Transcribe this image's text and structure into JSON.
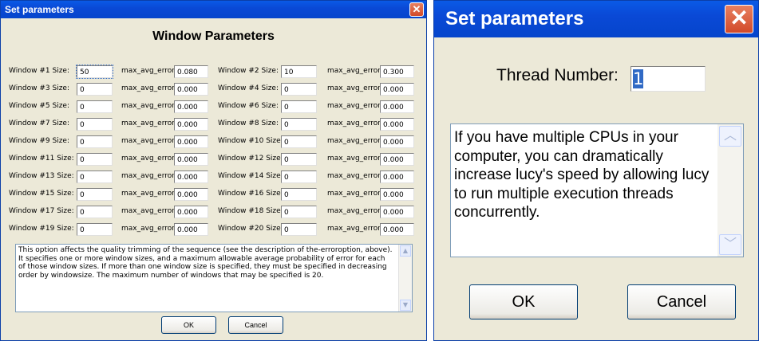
{
  "dialog1": {
    "title": "Set parameters",
    "heading": "Window Parameters",
    "error_label": "max_avg_error:",
    "rows": [
      {
        "left": {
          "label": "Window #1 Size:",
          "size": "50",
          "error": "0.080"
        },
        "right": {
          "label": "Window #2 Size:",
          "size": "10",
          "error": "0.300"
        }
      },
      {
        "left": {
          "label": "Window #3 Size:",
          "size": "0",
          "error": "0.000"
        },
        "right": {
          "label": "Window #4 Size:",
          "size": "0",
          "error": "0.000"
        }
      },
      {
        "left": {
          "label": "Window #5 Size:",
          "size": "0",
          "error": "0.000"
        },
        "right": {
          "label": "Window #6 Size:",
          "size": "0",
          "error": "0.000"
        }
      },
      {
        "left": {
          "label": "Window #7 Size:",
          "size": "0",
          "error": "0.000"
        },
        "right": {
          "label": "Window #8 Size:",
          "size": "0",
          "error": "0.000"
        }
      },
      {
        "left": {
          "label": "Window #9 Size:",
          "size": "0",
          "error": "0.000"
        },
        "right": {
          "label": "Window #10 Size:",
          "size": "0",
          "error": "0.000"
        }
      },
      {
        "left": {
          "label": "Window #11 Size:",
          "size": "0",
          "error": "0.000"
        },
        "right": {
          "label": "Window #12 Size:",
          "size": "0",
          "error": "0.000"
        }
      },
      {
        "left": {
          "label": "Window #13 Size:",
          "size": "0",
          "error": "0.000"
        },
        "right": {
          "label": "Window #14 Size:",
          "size": "0",
          "error": "0.000"
        }
      },
      {
        "left": {
          "label": "Window #15 Size:",
          "size": "0",
          "error": "0.000"
        },
        "right": {
          "label": "Window #16 Size:",
          "size": "0",
          "error": "0.000"
        }
      },
      {
        "left": {
          "label": "Window #17 Size:",
          "size": "0",
          "error": "0.000"
        },
        "right": {
          "label": "Window #18 Size:",
          "size": "0",
          "error": "0.000"
        }
      },
      {
        "left": {
          "label": "Window #19 Size:",
          "size": "0",
          "error": "0.000"
        },
        "right": {
          "label": "Window #20 Size:",
          "size": "0",
          "error": "0.000"
        }
      }
    ],
    "description": "This option affects the quality trimming of the sequence (see the description of the-erroroption, above). It specifies one or more window sizes, and a maximum allowable average probability of error for each of those window sizes. If more than one window size is specified, they must be specified in decreasing order by windowsize. The maximum number of windows that may be specified is 20.",
    "ok_label": "OK",
    "cancel_label": "Cancel"
  },
  "dialog2": {
    "title": "Set parameters",
    "thread_label": "Thread Number:",
    "thread_value": "1",
    "description": "If you have multiple CPUs in your computer, you can dramatically increase lucy's speed by allowing lucy to run multiple execution threads concurrently.",
    "ok_label": "OK",
    "cancel_label": "Cancel"
  },
  "icons": {
    "close": "close-icon",
    "scroll_up": "scroll-up-icon",
    "scroll_down": "scroll-down-icon"
  },
  "colors": {
    "titlebar": "#0a49d6",
    "dialog_bg": "#ece9d8",
    "close_button": "#d24a2a",
    "selection": "#316ac5"
  }
}
